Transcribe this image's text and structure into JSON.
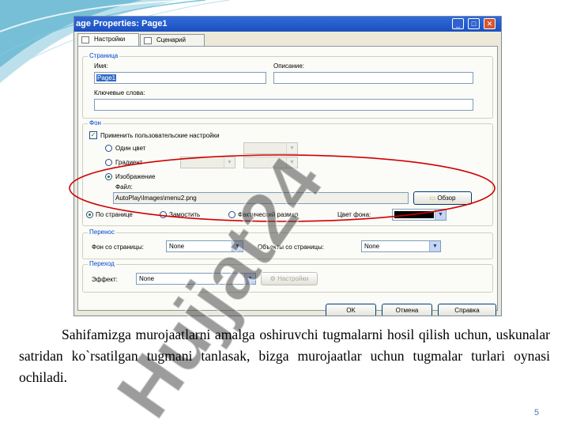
{
  "dialog": {
    "title": "age Properties: Page1",
    "tabs": [
      {
        "label": "Настройки",
        "active": true
      },
      {
        "label": "Сценарий",
        "active": false
      }
    ],
    "page_group": {
      "title": "Страница",
      "name_label": "Имя:",
      "name_value": "Page1",
      "description_label": "Описание:",
      "description_value": "",
      "keywords_label": "Ключевые слова:",
      "keywords_value": ""
    },
    "background_group": {
      "title": "Фон",
      "use_custom_label": "Применить пользовательские настройки",
      "use_custom_checked": true,
      "solid_color_label": "Один цвет",
      "gradient_label": "Градиент",
      "image_label": "Изображение",
      "image_selected": true,
      "file_label": "Файл:",
      "file_value": "AutoPlay\\Images\\menu2.png",
      "browse_label": "Обзор",
      "mode_center_label": "По странице",
      "mode_tile_label": "Замостить",
      "mode_actual_label": "Фактический размер",
      "mode_selected": "По странице",
      "bg_color_label": "Цвет фона:"
    },
    "transfer_group": {
      "title": "Перенос",
      "bg_from_page_label": "Фон со страницы:",
      "bg_from_page_value": "None",
      "objects_from_page_label": "Объекты со страницы:",
      "objects_from_page_value": "None"
    },
    "transition_group": {
      "title": "Переход",
      "effect_label": "Эффект:",
      "effect_value": "None",
      "settings_label": "Настройки"
    },
    "buttons": {
      "ok": "OK",
      "cancel": "Отмена",
      "help": "Справка"
    }
  },
  "watermark": "Hujjat24",
  "caption": "Sahifamizga murojaatlarni amalga oshiruvchi tugmalarni hosil qilish uchun, uskunalar satridan ko`rsatilgan tugmani tanlasak, bizga murojaatlar uchun tugmalar turlari oynasi ochiladi.",
  "page_number": "5",
  "colors": {
    "title_bar": "#1f56c8",
    "group_title": "#0046d5",
    "highlight_ellipse": "#d00000",
    "watermark": "#4a4a4a",
    "page_number": "#4a7ab8",
    "decoration": "#49a9c8"
  }
}
